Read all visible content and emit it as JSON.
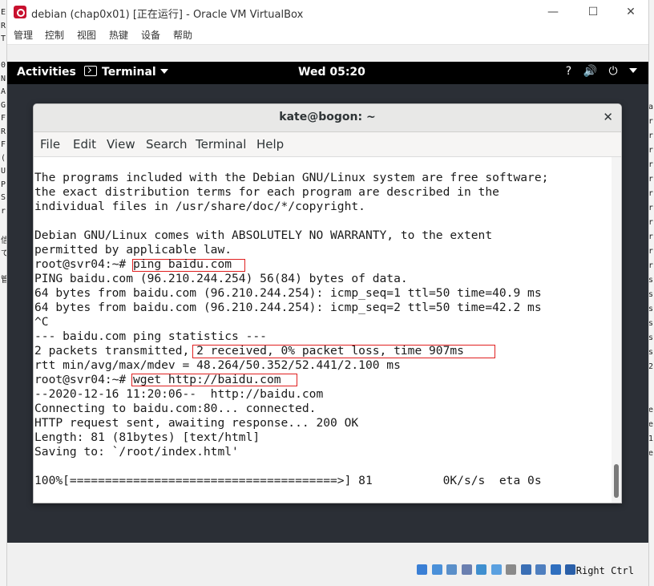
{
  "background": {
    "left_chars": [
      "E",
      "R",
      "T",
      "",
      "0",
      "N",
      "A",
      "G",
      "F",
      "R",
      "F",
      "(",
      "U",
      "P",
      "S",
      "r",
      "",
      "信",
      "で",
      "",
      "管",
      "",
      "",
      "",
      ""
    ],
    "right_chars": [
      "a",
      "r",
      "r",
      "r",
      "r",
      "r",
      "r",
      "r",
      "r",
      "r",
      "r",
      "r",
      "s",
      "s",
      "s",
      "s",
      "s",
      "s",
      "2",
      "",
      "",
      "e",
      "e",
      "1",
      "e"
    ]
  },
  "vbox": {
    "title": "debian (chap0x01) [正在运行] - Oracle VM VirtualBox",
    "window_controls": {
      "minimize": "—",
      "maximize": "☐",
      "close": "✕"
    },
    "menu": [
      "管理",
      "控制",
      "视图",
      "热键",
      "设备",
      "帮助"
    ],
    "host_key": "Right Ctrl",
    "status_icons": [
      "disk-icon",
      "optical-icon",
      "network-icon",
      "usb-icon",
      "shared-folder-icon",
      "display-icon",
      "recording-icon",
      "video-capture-icon",
      "vm-icon",
      "mouse-icon",
      "keyboard-icon"
    ]
  },
  "gnome": {
    "activities": "Activities",
    "app_menu": "Terminal",
    "clock": "Wed 05:20",
    "status": {
      "network": "?",
      "volume": "🔊",
      "power": "⏻"
    }
  },
  "terminal": {
    "title": "kate@bogon: ~",
    "menu": [
      "File",
      "Edit",
      "View",
      "Search",
      "Terminal",
      "Help"
    ],
    "lines": [
      "The programs included with the Debian GNU/Linux system are free software;",
      "the exact distribution terms for each program are described in the",
      "individual files in /usr/share/doc/*/copyright.",
      "",
      "Debian GNU/Linux comes with ABSOLUTELY NO WARRANTY, to the extent",
      "permitted by applicable law.",
      "root@svr04:~# ping baidu.com",
      "PING baidu.com (96.210.244.254) 56(84) bytes of data.",
      "64 bytes from baidu.com (96.210.244.254): icmp_seq=1 ttl=50 time=40.9 ms",
      "64 bytes from baidu.com (96.210.244.254): icmp_seq=2 ttl=50 time=42.2 ms",
      "^C",
      "--- baidu.com ping statistics ---",
      "2 packets transmitted, 2 received, 0% packet loss, time 907ms",
      "rtt min/avg/max/mdev = 48.264/50.352/52.441/2.100 ms",
      "root@svr04:~# wget http://baidu.com",
      "--2020-12-16 11:20:06--  http://baidu.com",
      "Connecting to baidu.com:80... connected.",
      "HTTP request sent, awaiting response... 200 OK",
      "Length: 81 (81bytes) [text/html]",
      "Saving to: `/root/index.html'",
      "",
      "100%[======================================>] 81          0K/s/s  eta 0s"
    ]
  }
}
